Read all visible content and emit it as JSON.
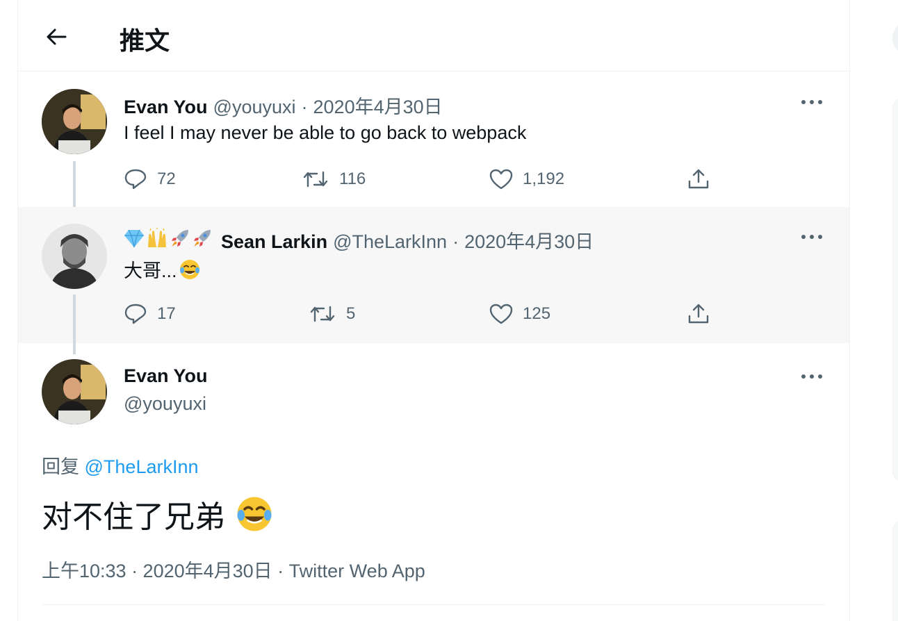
{
  "header": {
    "title": "推文"
  },
  "tweets": [
    {
      "name": "Evan You",
      "handle": "@youyuxi",
      "dot": "·",
      "date": "2020年4月30日",
      "text": "I feel I may never be able to go back to webpack",
      "replies": "72",
      "retweets": "116",
      "likes": "1,192"
    },
    {
      "badges": [
        "gem-stone-emoji",
        "raising-hands-emoji",
        "rocket-emoji",
        "rocket-emoji"
      ],
      "name": "Sean Larkin",
      "handle": "@TheLarkInn",
      "dot": "·",
      "date": "2020年4月30日",
      "text": "大哥...",
      "text_emoji": "face-with-tears-of-joy-emoji",
      "replies": "17",
      "retweets": "5",
      "likes": "125"
    }
  ],
  "focus": {
    "name": "Evan You",
    "handle": "@youyuxi",
    "replying_prefix": "回复 ",
    "replying_to": "@TheLarkInn",
    "text": "对不住了兄弟",
    "text_emoji": "face-with-tears-of-joy-emoji",
    "timestamp": "上午10:33 · 2020年4月30日 · Twitter Web App"
  },
  "colors": {
    "accent": "#1d9bf0",
    "text_primary": "#0f1419",
    "text_secondary": "#536471",
    "border": "#eff3f4",
    "highlight_bg": "#f7f7f7"
  }
}
